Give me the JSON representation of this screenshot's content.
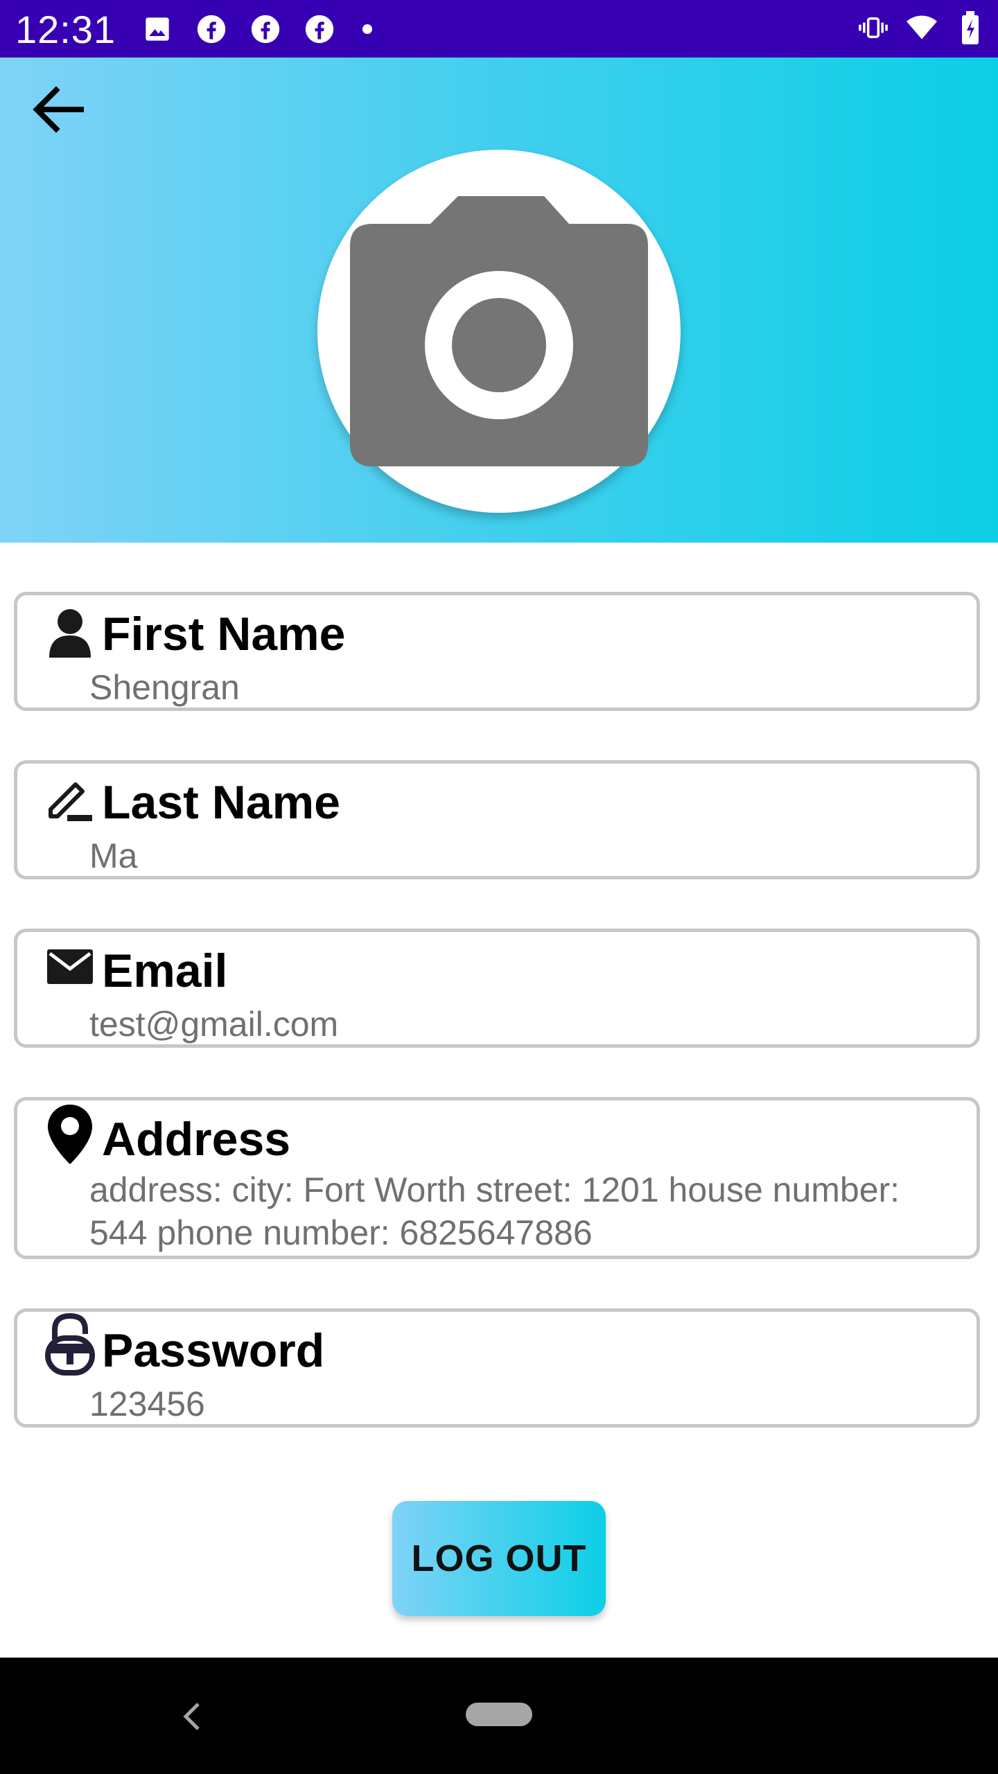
{
  "status_bar": {
    "time": "12:31",
    "left_icons": [
      "image-icon",
      "facebook-icon",
      "facebook-icon",
      "facebook-icon",
      "dot-icon"
    ],
    "right_icons": [
      "vibrate-icon",
      "wifi-icon",
      "battery-icon"
    ],
    "background_color": "#3700b3"
  },
  "header": {
    "back_icon": "arrow-left-icon",
    "avatar_icon": "camera-icon",
    "gradient": [
      "#7fd3f7",
      "#0ccfe6"
    ]
  },
  "fields": [
    {
      "icon": "person-icon",
      "label": "First Name",
      "value": "Shengran"
    },
    {
      "icon": "pencil-icon",
      "label": "Last Name",
      "value": "Ma"
    },
    {
      "icon": "mail-icon",
      "label": "Email",
      "value": "test@gmail.com"
    },
    {
      "icon": "location-pin-icon",
      "label": "Address",
      "value": "address: city: Fort Worth street: 1201 house number: 544 phone number: 6825647886"
    },
    {
      "icon": "unlock-icon",
      "label": "Password",
      "value": "123456"
    }
  ],
  "logout_label": "LOG OUT",
  "nav_bar": {
    "back_icon": "chevron-left-icon",
    "home_icon": "home-pill-icon"
  }
}
